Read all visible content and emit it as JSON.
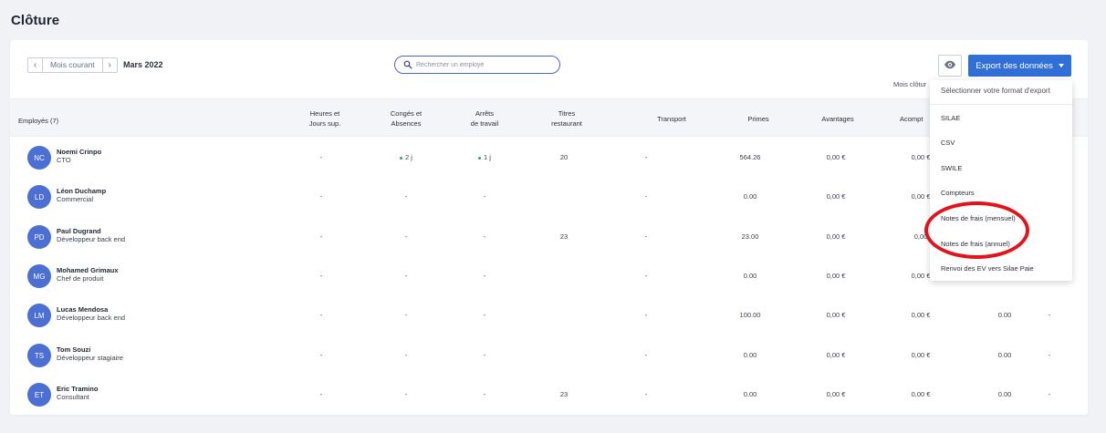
{
  "page": {
    "title": "Clôture"
  },
  "toolbar": {
    "prev": "‹",
    "next": "›",
    "current_month_button": "Mois courant",
    "month_label": "Mars 2022",
    "search_placeholder": "Rechercher un employé",
    "export_button": "Export des données",
    "closed_months_label": "Mois clôtur"
  },
  "table": {
    "headers": {
      "employees": "Employés (7)",
      "overtime_line1": "Heures et",
      "overtime_line2": "Jours sup.",
      "leaves_line1": "Congés et",
      "leaves_line2": "Absences",
      "sick_line1": "Arrêts",
      "sick_line2": "de travail",
      "meal_line1": "Titres",
      "meal_line2": "restaurant",
      "transport": "Transport",
      "bonuses": "Primes",
      "benefits": "Avantages",
      "advances": "Acompt"
    },
    "rows": [
      {
        "initials": "NC",
        "name": "Noemi Crinpo",
        "role": "CTO",
        "overtime": "-",
        "leaves": "2 j",
        "sick": "1 j",
        "meal": "20",
        "transport": "-",
        "bonuses": "564.26",
        "benefits": "0,00 €",
        "advances": "0,00 €",
        "extra": "",
        "last": ""
      },
      {
        "initials": "LD",
        "name": "Léon Duchamp",
        "role": "Commercial",
        "overtime": "-",
        "leaves": "-",
        "sick": "-",
        "meal": "",
        "transport": "-",
        "bonuses": "0.00",
        "benefits": "0,00 €",
        "advances": "0,00 €",
        "extra": "",
        "last": ""
      },
      {
        "initials": "PD",
        "name": "Paul Dugrand",
        "role": "Développeur back end",
        "overtime": "-",
        "leaves": "-",
        "sick": "-",
        "meal": "23",
        "transport": "-",
        "bonuses": "23.00",
        "benefits": "0,00 €",
        "advances": "0,00",
        "extra": "",
        "last": ""
      },
      {
        "initials": "MG",
        "name": "Mohamed Grimaux",
        "role": "Chef de produit",
        "overtime": "-",
        "leaves": "-",
        "sick": "-",
        "meal": "",
        "transport": "-",
        "bonuses": "0.00",
        "benefits": "0,00 €",
        "advances": "0,00 €",
        "extra": "",
        "last": ""
      },
      {
        "initials": "LM",
        "name": "Lucas Mendosa",
        "role": "Développeur back end",
        "overtime": "-",
        "leaves": "-",
        "sick": "-",
        "meal": "",
        "transport": "-",
        "bonuses": "100.00",
        "benefits": "0,00 €",
        "advances": "0,00 €",
        "extra": "0.00",
        "last": "-"
      },
      {
        "initials": "TS",
        "name": "Tom Souzi",
        "role": "Développeur stagiaire",
        "overtime": "-",
        "leaves": "-",
        "sick": "-",
        "meal": "",
        "transport": "-",
        "bonuses": "0.00",
        "benefits": "0,00 €",
        "advances": "0,00 €",
        "extra": "0.00",
        "last": "-"
      },
      {
        "initials": "ET",
        "name": "Eric Tramino",
        "role": "Consultant",
        "overtime": "-",
        "leaves": "-",
        "sick": "-",
        "meal": "23",
        "transport": "-",
        "bonuses": "0.00",
        "benefits": "0,00 €",
        "advances": "0,00 €",
        "extra": "0.00",
        "last": "-"
      }
    ]
  },
  "dropdown": {
    "title": "Sélectionner votre format d'export",
    "items": [
      "SILAE",
      "CSV",
      "SWILE",
      "Compteurs",
      "Notes de frais (mensuel)",
      "Notes de frais (annuel)",
      "Renvoi des EV vers Silae Paie"
    ]
  },
  "colors": {
    "accent": "#2f6fd6",
    "avatar": "#4c6fd3",
    "highlight": "#e3131b",
    "leave_dot": "#2aa37a"
  },
  "icons": {
    "search": "search-icon",
    "eye": "eye-icon",
    "caret": "caret-down-icon"
  }
}
